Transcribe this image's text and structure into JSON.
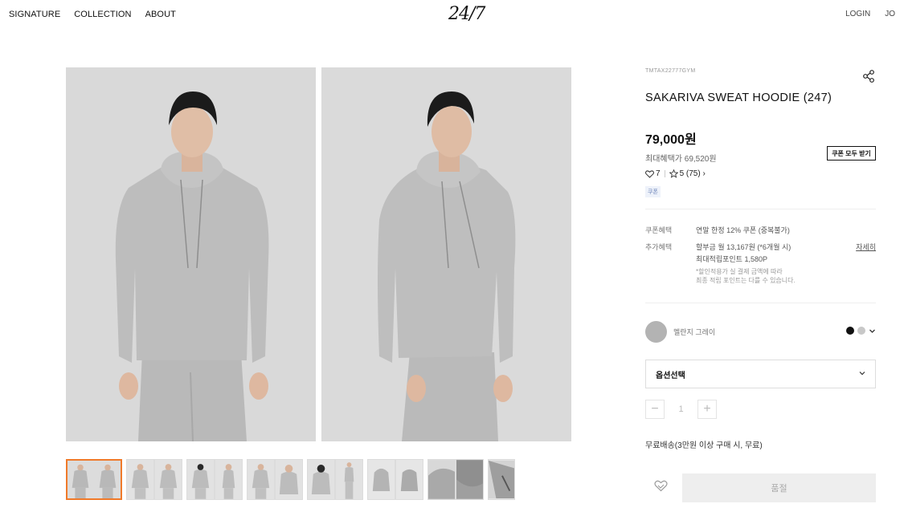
{
  "header": {
    "nav": [
      "SIGNATURE",
      "COLLECTION",
      "ABOUT"
    ],
    "logo": "24/7",
    "login": "LOGIN",
    "user": "JO"
  },
  "product": {
    "code": "TMTAX22777GYM",
    "title": "SAKARIVA SWEAT HOODIE (247)",
    "price": "79,000원",
    "max_benefit": "최대혜택가 69,520원",
    "coupon_button": "쿠폰 모두 받기",
    "likes": "7",
    "rating": "5 (75) ›",
    "tag": "쿠폰"
  },
  "benefits": {
    "coupon_label": "쿠폰혜택",
    "coupon_value": "연말 한정 12% 쿠폰 (중복불가)",
    "extra_label": "추가혜택",
    "installment": "할부금 월 13,167원 (*6개월 시)",
    "points": "최대적립포인트 1,580P",
    "note_line1": "*할인적용가 실 결제 금액에 따라",
    "note_line2": "최종 적립 포인트는 다를 수 있습니다.",
    "detail_link": "자세히"
  },
  "color": {
    "name": "멜란지 그레이",
    "swatch": "#b3b3b3",
    "options": [
      "#111111",
      "#c8c8c8"
    ]
  },
  "option_select": "옵션선택",
  "quantity": "1",
  "shipping": "무료배송(3만원 이상 구매 시, 무료)",
  "soldout_button": "품절",
  "icons": {
    "share": "share-icon",
    "heart": "heart-icon",
    "star": "star-icon",
    "chevron": "chevron-down-icon"
  },
  "accent_color": "#f07a2a"
}
